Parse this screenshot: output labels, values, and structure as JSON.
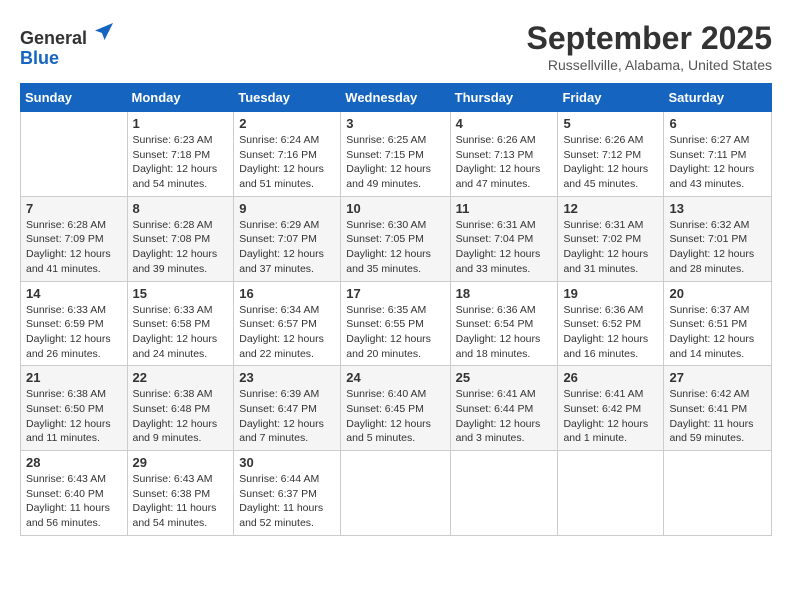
{
  "logo": {
    "general": "General",
    "blue": "Blue"
  },
  "title": "September 2025",
  "subtitle": "Russellville, Alabama, United States",
  "weekdays": [
    "Sunday",
    "Monday",
    "Tuesday",
    "Wednesday",
    "Thursday",
    "Friday",
    "Saturday"
  ],
  "weeks": [
    [
      {
        "day": "",
        "info": ""
      },
      {
        "day": "1",
        "info": "Sunrise: 6:23 AM\nSunset: 7:18 PM\nDaylight: 12 hours and 54 minutes."
      },
      {
        "day": "2",
        "info": "Sunrise: 6:24 AM\nSunset: 7:16 PM\nDaylight: 12 hours and 51 minutes."
      },
      {
        "day": "3",
        "info": "Sunrise: 6:25 AM\nSunset: 7:15 PM\nDaylight: 12 hours and 49 minutes."
      },
      {
        "day": "4",
        "info": "Sunrise: 6:26 AM\nSunset: 7:13 PM\nDaylight: 12 hours and 47 minutes."
      },
      {
        "day": "5",
        "info": "Sunrise: 6:26 AM\nSunset: 7:12 PM\nDaylight: 12 hours and 45 minutes."
      },
      {
        "day": "6",
        "info": "Sunrise: 6:27 AM\nSunset: 7:11 PM\nDaylight: 12 hours and 43 minutes."
      }
    ],
    [
      {
        "day": "7",
        "info": "Sunrise: 6:28 AM\nSunset: 7:09 PM\nDaylight: 12 hours and 41 minutes."
      },
      {
        "day": "8",
        "info": "Sunrise: 6:28 AM\nSunset: 7:08 PM\nDaylight: 12 hours and 39 minutes."
      },
      {
        "day": "9",
        "info": "Sunrise: 6:29 AM\nSunset: 7:07 PM\nDaylight: 12 hours and 37 minutes."
      },
      {
        "day": "10",
        "info": "Sunrise: 6:30 AM\nSunset: 7:05 PM\nDaylight: 12 hours and 35 minutes."
      },
      {
        "day": "11",
        "info": "Sunrise: 6:31 AM\nSunset: 7:04 PM\nDaylight: 12 hours and 33 minutes."
      },
      {
        "day": "12",
        "info": "Sunrise: 6:31 AM\nSunset: 7:02 PM\nDaylight: 12 hours and 31 minutes."
      },
      {
        "day": "13",
        "info": "Sunrise: 6:32 AM\nSunset: 7:01 PM\nDaylight: 12 hours and 28 minutes."
      }
    ],
    [
      {
        "day": "14",
        "info": "Sunrise: 6:33 AM\nSunset: 6:59 PM\nDaylight: 12 hours and 26 minutes."
      },
      {
        "day": "15",
        "info": "Sunrise: 6:33 AM\nSunset: 6:58 PM\nDaylight: 12 hours and 24 minutes."
      },
      {
        "day": "16",
        "info": "Sunrise: 6:34 AM\nSunset: 6:57 PM\nDaylight: 12 hours and 22 minutes."
      },
      {
        "day": "17",
        "info": "Sunrise: 6:35 AM\nSunset: 6:55 PM\nDaylight: 12 hours and 20 minutes."
      },
      {
        "day": "18",
        "info": "Sunrise: 6:36 AM\nSunset: 6:54 PM\nDaylight: 12 hours and 18 minutes."
      },
      {
        "day": "19",
        "info": "Sunrise: 6:36 AM\nSunset: 6:52 PM\nDaylight: 12 hours and 16 minutes."
      },
      {
        "day": "20",
        "info": "Sunrise: 6:37 AM\nSunset: 6:51 PM\nDaylight: 12 hours and 14 minutes."
      }
    ],
    [
      {
        "day": "21",
        "info": "Sunrise: 6:38 AM\nSunset: 6:50 PM\nDaylight: 12 hours and 11 minutes."
      },
      {
        "day": "22",
        "info": "Sunrise: 6:38 AM\nSunset: 6:48 PM\nDaylight: 12 hours and 9 minutes."
      },
      {
        "day": "23",
        "info": "Sunrise: 6:39 AM\nSunset: 6:47 PM\nDaylight: 12 hours and 7 minutes."
      },
      {
        "day": "24",
        "info": "Sunrise: 6:40 AM\nSunset: 6:45 PM\nDaylight: 12 hours and 5 minutes."
      },
      {
        "day": "25",
        "info": "Sunrise: 6:41 AM\nSunset: 6:44 PM\nDaylight: 12 hours and 3 minutes."
      },
      {
        "day": "26",
        "info": "Sunrise: 6:41 AM\nSunset: 6:42 PM\nDaylight: 12 hours and 1 minute."
      },
      {
        "day": "27",
        "info": "Sunrise: 6:42 AM\nSunset: 6:41 PM\nDaylight: 11 hours and 59 minutes."
      }
    ],
    [
      {
        "day": "28",
        "info": "Sunrise: 6:43 AM\nSunset: 6:40 PM\nDaylight: 11 hours and 56 minutes."
      },
      {
        "day": "29",
        "info": "Sunrise: 6:43 AM\nSunset: 6:38 PM\nDaylight: 11 hours and 54 minutes."
      },
      {
        "day": "30",
        "info": "Sunrise: 6:44 AM\nSunset: 6:37 PM\nDaylight: 11 hours and 52 minutes."
      },
      {
        "day": "",
        "info": ""
      },
      {
        "day": "",
        "info": ""
      },
      {
        "day": "",
        "info": ""
      },
      {
        "day": "",
        "info": ""
      }
    ]
  ]
}
